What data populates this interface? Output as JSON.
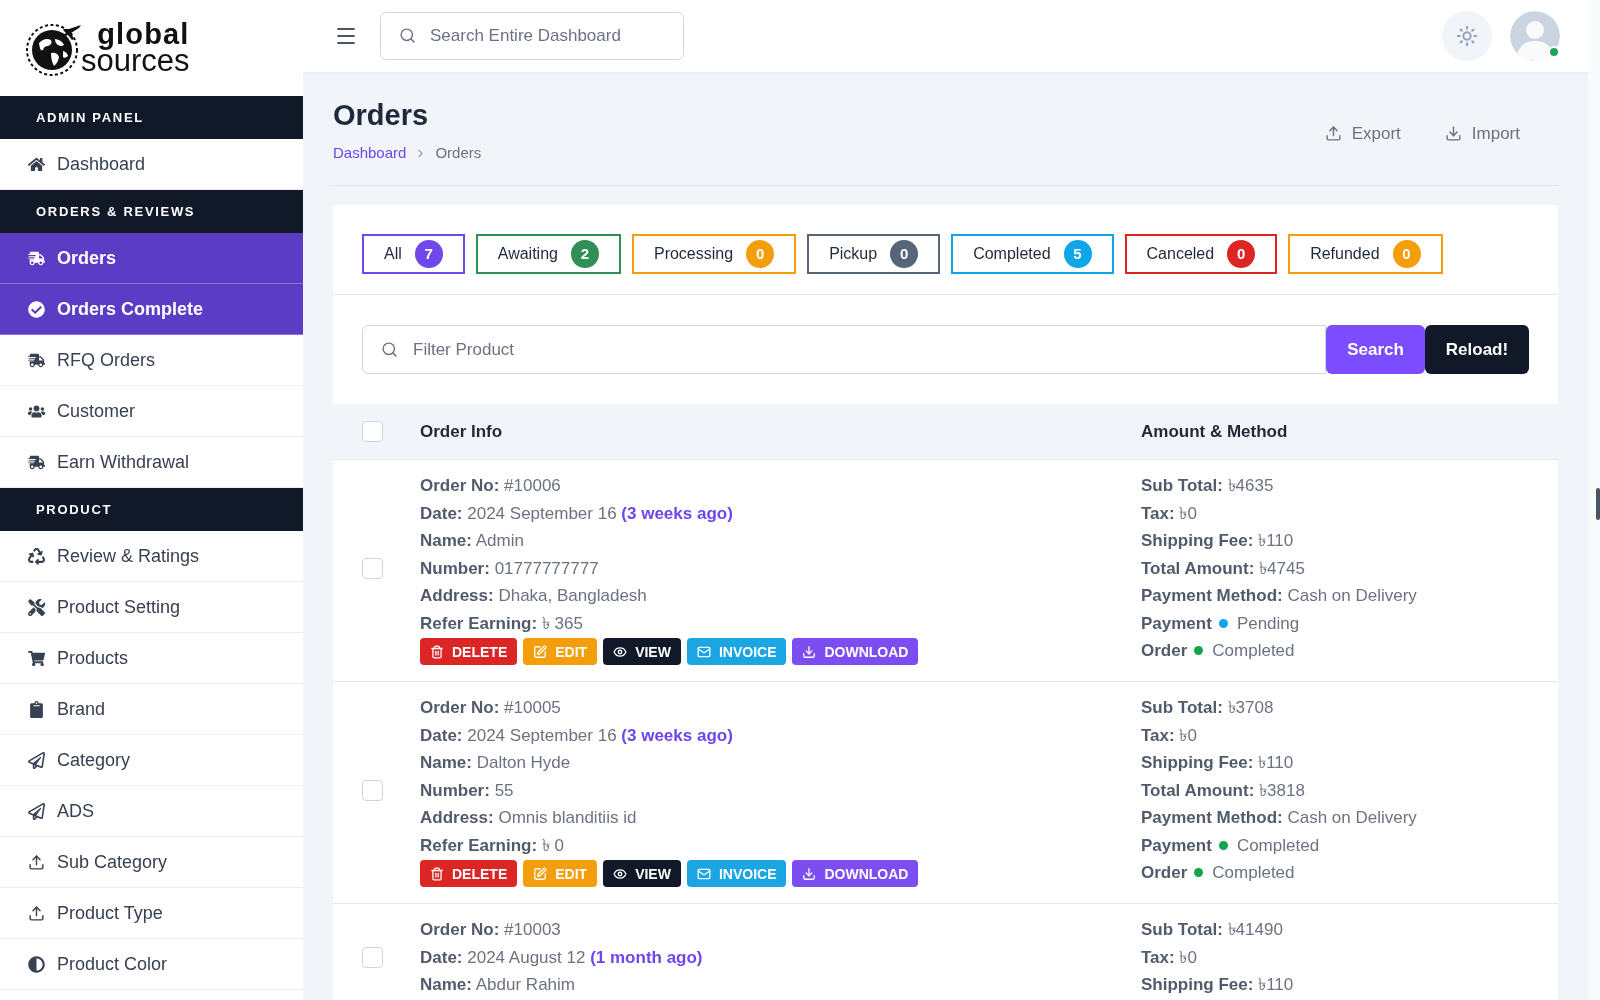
{
  "logo": {
    "line_1": "global",
    "line_2": "sources"
  },
  "sidebar": {
    "sections": [
      {
        "title": "ADMIN PANEL",
        "items": [
          {
            "label": "Dashboard",
            "selected": false
          }
        ]
      },
      {
        "title": "ORDERS & REVIEWS",
        "items": [
          {
            "label": "Orders",
            "selected": true
          },
          {
            "label": "Orders Complete",
            "selected": true
          },
          {
            "label": "RFQ Orders",
            "selected": false
          },
          {
            "label": "Customer",
            "selected": false
          },
          {
            "label": "Earn Withdrawal",
            "selected": false
          }
        ]
      },
      {
        "title": "PRODUCT",
        "items": [
          {
            "label": "Review & Ratings",
            "selected": false
          },
          {
            "label": "Product Setting",
            "selected": false
          },
          {
            "label": "Products",
            "selected": false
          },
          {
            "label": "Brand",
            "selected": false
          },
          {
            "label": "Category",
            "selected": false
          },
          {
            "label": "ADS",
            "selected": false
          },
          {
            "label": "Sub Category",
            "selected": false
          },
          {
            "label": "Product Type",
            "selected": false
          },
          {
            "label": "Product Color",
            "selected": false
          }
        ]
      }
    ]
  },
  "top_bar": {
    "search": {
      "placeholder": "Search Entire Dashboard"
    },
    "user": {
      "online": true
    }
  },
  "page": {
    "title": "Orders",
    "breadcrumb": [
      {
        "label": "Dashboard",
        "kind": "link"
      },
      {
        "label": "Orders",
        "kind": "current"
      }
    ],
    "actions": [
      "Export",
      "Import"
    ]
  },
  "status_tabs": [
    {
      "label": "All",
      "count": "7",
      "color": "#7047eb"
    },
    {
      "label": "Awaiting",
      "count": "2",
      "color": "#2f8f57"
    },
    {
      "label": "Processing",
      "count": "0",
      "color": "#f59e0b"
    },
    {
      "label": "Pickup",
      "count": "0",
      "color": "#56657a"
    },
    {
      "label": "Completed",
      "count": "5",
      "color": "#0ea5e9"
    },
    {
      "label": "Canceled",
      "count": "0",
      "color": "#dc2626"
    },
    {
      "label": "Refunded",
      "count": "0",
      "color": "#f59e0b"
    }
  ],
  "filter": {
    "placeholder": "Filter Product",
    "buttons": [
      "Search",
      "Reload!"
    ]
  },
  "table": {
    "select_all_checked": false,
    "columns": [
      "Order Info",
      "Amount & Method"
    ],
    "rows": [
      {
        "checked": false,
        "info": [
          {
            "label": "Order No:",
            "value": "#10006"
          },
          {
            "label": "Date:",
            "value": "2024 September 16",
            "note": "(3 weeks ago)"
          },
          {
            "label": "Name:",
            "value": "Admin"
          },
          {
            "label": "Number:",
            "value": "01777777777"
          },
          {
            "label": "Address:",
            "value": "Dhaka, Bangladesh"
          },
          {
            "label": "Refer Earning:",
            "value": "৳ 365"
          }
        ],
        "actions": [
          {
            "label": "DELETE",
            "color": "#dc2626"
          },
          {
            "label": "EDIT",
            "color": "#f59e0b"
          },
          {
            "label": "VIEW",
            "color": "#111827"
          },
          {
            "label": "INVOICE",
            "color": "#1ba5e3"
          },
          {
            "label": "DOWNLOAD",
            "color": "#7c4df0"
          }
        ],
        "amounts": [
          {
            "kind": "amount",
            "label": "Sub Total:",
            "value": "৳4635"
          },
          {
            "kind": "amount",
            "label": "Tax:",
            "value": "৳0"
          },
          {
            "kind": "amount",
            "label": "Shipping Fee:",
            "value": "৳110"
          },
          {
            "kind": "amount",
            "label": "Total Amount:",
            "value": "৳4745"
          },
          {
            "kind": "amount",
            "label": "Payment Method:",
            "value": "Cash on Delivery"
          },
          {
            "kind": "status",
            "label": "Payment",
            "value": "Pending",
            "color": "#0ea5e9"
          },
          {
            "kind": "status",
            "label": "Order",
            "value": "Completed",
            "color": "#16a34a"
          }
        ]
      },
      {
        "checked": false,
        "info": [
          {
            "label": "Order No:",
            "value": "#10005"
          },
          {
            "label": "Date:",
            "value": "2024 September 16",
            "note": "(3 weeks ago)"
          },
          {
            "label": "Name:",
            "value": "Dalton Hyde"
          },
          {
            "label": "Number:",
            "value": "55"
          },
          {
            "label": "Address:",
            "value": "Omnis blanditiis id"
          },
          {
            "label": "Refer Earning:",
            "value": "৳ 0"
          }
        ],
        "actions": [
          {
            "label": "DELETE",
            "color": "#dc2626"
          },
          {
            "label": "EDIT",
            "color": "#f59e0b"
          },
          {
            "label": "VIEW",
            "color": "#111827"
          },
          {
            "label": "INVOICE",
            "color": "#1ba5e3"
          },
          {
            "label": "DOWNLOAD",
            "color": "#7c4df0"
          }
        ],
        "amounts": [
          {
            "kind": "amount",
            "label": "Sub Total:",
            "value": "৳3708"
          },
          {
            "kind": "amount",
            "label": "Tax:",
            "value": "৳0"
          },
          {
            "kind": "amount",
            "label": "Shipping Fee:",
            "value": "৳110"
          },
          {
            "kind": "amount",
            "label": "Total Amount:",
            "value": "৳3818"
          },
          {
            "kind": "amount",
            "label": "Payment Method:",
            "value": "Cash on Delivery"
          },
          {
            "kind": "status",
            "label": "Payment",
            "value": "Completed",
            "color": "#16a34a"
          },
          {
            "kind": "status",
            "label": "Order",
            "value": "Completed",
            "color": "#16a34a"
          }
        ]
      },
      {
        "checked": false,
        "info": [
          {
            "label": "Order No:",
            "value": "#10003"
          },
          {
            "label": "Date:",
            "value": "2024 August 12",
            "note": "(1 month ago)"
          },
          {
            "label": "Name:",
            "value": "Abdur Rahim"
          }
        ],
        "amounts": [
          {
            "kind": "amount",
            "label": "Sub Total:",
            "value": "৳41490"
          },
          {
            "kind": "amount",
            "label": "Tax:",
            "value": "৳0"
          },
          {
            "kind": "amount",
            "label": "Shipping Fee:",
            "value": "৳110"
          }
        ]
      }
    ]
  }
}
